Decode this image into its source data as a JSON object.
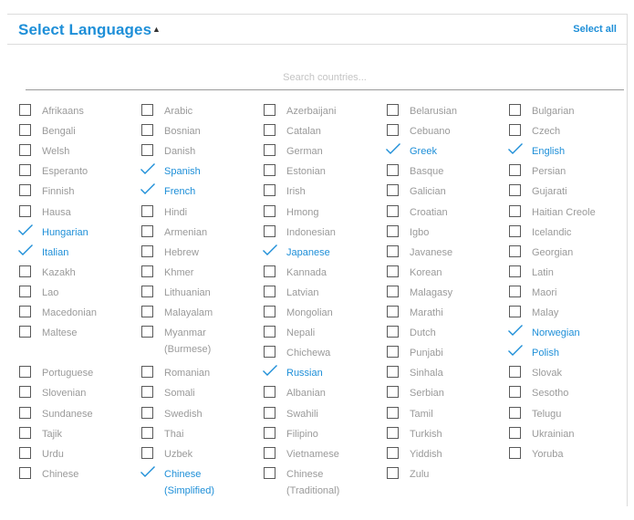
{
  "header": {
    "title": "Select Languages",
    "caret_icon": "caret-up-icon",
    "select_all_label": "Select all"
  },
  "search": {
    "placeholder": "Search countries...",
    "value": ""
  },
  "colors": {
    "accent": "#1e8fd8",
    "label_unchecked": "#9a9a9a",
    "checkbox_border": "#5a5a5a",
    "divider": "#dcdcdc"
  },
  "columns": [
    [
      {
        "label": "Afrikaans",
        "checked": false,
        "row": 0
      },
      {
        "label": "Bengali",
        "checked": false,
        "row": 1
      },
      {
        "label": "Welsh",
        "checked": false,
        "row": 2
      },
      {
        "label": "Esperanto",
        "checked": false,
        "row": 3
      },
      {
        "label": "Finnish",
        "checked": false,
        "row": 4
      },
      {
        "label": "Hausa",
        "checked": false,
        "row": 5
      },
      {
        "label": "Hungarian",
        "checked": true,
        "row": 6
      },
      {
        "label": "Italian",
        "checked": true,
        "row": 7
      },
      {
        "label": "Kazakh",
        "checked": false,
        "row": 8
      },
      {
        "label": "Lao",
        "checked": false,
        "row": 9
      },
      {
        "label": "Macedonian",
        "checked": false,
        "row": 10
      },
      {
        "label": "Maltese",
        "checked": false,
        "row": 11
      },
      {
        "label": "Portuguese",
        "checked": false,
        "row": 13
      },
      {
        "label": "Slovenian",
        "checked": false,
        "row": 14
      },
      {
        "label": "Sundanese",
        "checked": false,
        "row": 15
      },
      {
        "label": "Tajik",
        "checked": false,
        "row": 16
      },
      {
        "label": "Urdu",
        "checked": false,
        "row": 17
      },
      {
        "label": "Chinese",
        "checked": false,
        "row": 18
      }
    ],
    [
      {
        "label": "Arabic",
        "checked": false,
        "row": 0
      },
      {
        "label": "Bosnian",
        "checked": false,
        "row": 1
      },
      {
        "label": "Danish",
        "checked": false,
        "row": 2
      },
      {
        "label": "Spanish",
        "checked": true,
        "row": 3
      },
      {
        "label": "French",
        "checked": true,
        "row": 4
      },
      {
        "label": "Hindi",
        "checked": false,
        "row": 5
      },
      {
        "label": "Armenian",
        "checked": false,
        "row": 6
      },
      {
        "label": "Hebrew",
        "checked": false,
        "row": 7
      },
      {
        "label": "Khmer",
        "checked": false,
        "row": 8
      },
      {
        "label": "Lithuanian",
        "checked": false,
        "row": 9
      },
      {
        "label": "Malayalam",
        "checked": false,
        "row": 10
      },
      {
        "label": "Myanmar",
        "label2": "(Burmese)",
        "checked": false,
        "row": 11
      },
      {
        "label": "Romanian",
        "checked": false,
        "row": 13
      },
      {
        "label": "Somali",
        "checked": false,
        "row": 14
      },
      {
        "label": "Swedish",
        "checked": false,
        "row": 15
      },
      {
        "label": "Thai",
        "checked": false,
        "row": 16
      },
      {
        "label": "Uzbek",
        "checked": false,
        "row": 17
      },
      {
        "label": "Chinese",
        "label2": "(Simplified)",
        "checked": true,
        "row": 18
      }
    ],
    [
      {
        "label": "Azerbaijani",
        "checked": false,
        "row": 0
      },
      {
        "label": "Catalan",
        "checked": false,
        "row": 1
      },
      {
        "label": "German",
        "checked": false,
        "row": 2
      },
      {
        "label": "Estonian",
        "checked": false,
        "row": 3
      },
      {
        "label": "Irish",
        "checked": false,
        "row": 4
      },
      {
        "label": "Hmong",
        "checked": false,
        "row": 5
      },
      {
        "label": "Indonesian",
        "checked": false,
        "row": 6
      },
      {
        "label": "Japanese",
        "checked": true,
        "row": 7
      },
      {
        "label": "Kannada",
        "checked": false,
        "row": 8
      },
      {
        "label": "Latvian",
        "checked": false,
        "row": 9
      },
      {
        "label": "Mongolian",
        "checked": false,
        "row": 10
      },
      {
        "label": "Nepali",
        "checked": false,
        "row": 11
      },
      {
        "label": "Chichewa",
        "checked": false,
        "row": 12
      },
      {
        "label": "Russian",
        "checked": true,
        "row": 13
      },
      {
        "label": "Albanian",
        "checked": false,
        "row": 14
      },
      {
        "label": "Swahili",
        "checked": false,
        "row": 15
      },
      {
        "label": "Filipino",
        "checked": false,
        "row": 16
      },
      {
        "label": "Vietnamese",
        "checked": false,
        "row": 17
      },
      {
        "label": "Chinese",
        "label2": "(Traditional)",
        "checked": false,
        "row": 18
      }
    ],
    [
      {
        "label": "Belarusian",
        "checked": false,
        "row": 0
      },
      {
        "label": "Cebuano",
        "checked": false,
        "row": 1
      },
      {
        "label": "Greek",
        "checked": true,
        "row": 2
      },
      {
        "label": "Basque",
        "checked": false,
        "row": 3
      },
      {
        "label": "Galician",
        "checked": false,
        "row": 4
      },
      {
        "label": "Croatian",
        "checked": false,
        "row": 5
      },
      {
        "label": "Igbo",
        "checked": false,
        "row": 6
      },
      {
        "label": "Javanese",
        "checked": false,
        "row": 7
      },
      {
        "label": "Korean",
        "checked": false,
        "row": 8
      },
      {
        "label": "Malagasy",
        "checked": false,
        "row": 9
      },
      {
        "label": "Marathi",
        "checked": false,
        "row": 10
      },
      {
        "label": "Dutch",
        "checked": false,
        "row": 11
      },
      {
        "label": "Punjabi",
        "checked": false,
        "row": 12
      },
      {
        "label": "Sinhala",
        "checked": false,
        "row": 13
      },
      {
        "label": "Serbian",
        "checked": false,
        "row": 14
      },
      {
        "label": "Tamil",
        "checked": false,
        "row": 15
      },
      {
        "label": "Turkish",
        "checked": false,
        "row": 16
      },
      {
        "label": "Yiddish",
        "checked": false,
        "row": 17
      },
      {
        "label": "Zulu",
        "checked": false,
        "row": 18
      }
    ],
    [
      {
        "label": "Bulgarian",
        "checked": false,
        "row": 0
      },
      {
        "label": "Czech",
        "checked": false,
        "row": 1
      },
      {
        "label": "English",
        "checked": true,
        "row": 2
      },
      {
        "label": "Persian",
        "checked": false,
        "row": 3
      },
      {
        "label": "Gujarati",
        "checked": false,
        "row": 4
      },
      {
        "label": "Haitian Creole",
        "checked": false,
        "row": 5
      },
      {
        "label": "Icelandic",
        "checked": false,
        "row": 6
      },
      {
        "label": "Georgian",
        "checked": false,
        "row": 7
      },
      {
        "label": "Latin",
        "checked": false,
        "row": 8
      },
      {
        "label": "Maori",
        "checked": false,
        "row": 9
      },
      {
        "label": "Malay",
        "checked": false,
        "row": 10
      },
      {
        "label": "Norwegian",
        "checked": true,
        "row": 11
      },
      {
        "label": "Polish",
        "checked": true,
        "row": 12
      },
      {
        "label": "Slovak",
        "checked": false,
        "row": 13
      },
      {
        "label": "Sesotho",
        "checked": false,
        "row": 14
      },
      {
        "label": "Telugu",
        "checked": false,
        "row": 15
      },
      {
        "label": "Ukrainian",
        "checked": false,
        "row": 16
      },
      {
        "label": "Yoruba",
        "checked": false,
        "row": 17
      }
    ]
  ]
}
